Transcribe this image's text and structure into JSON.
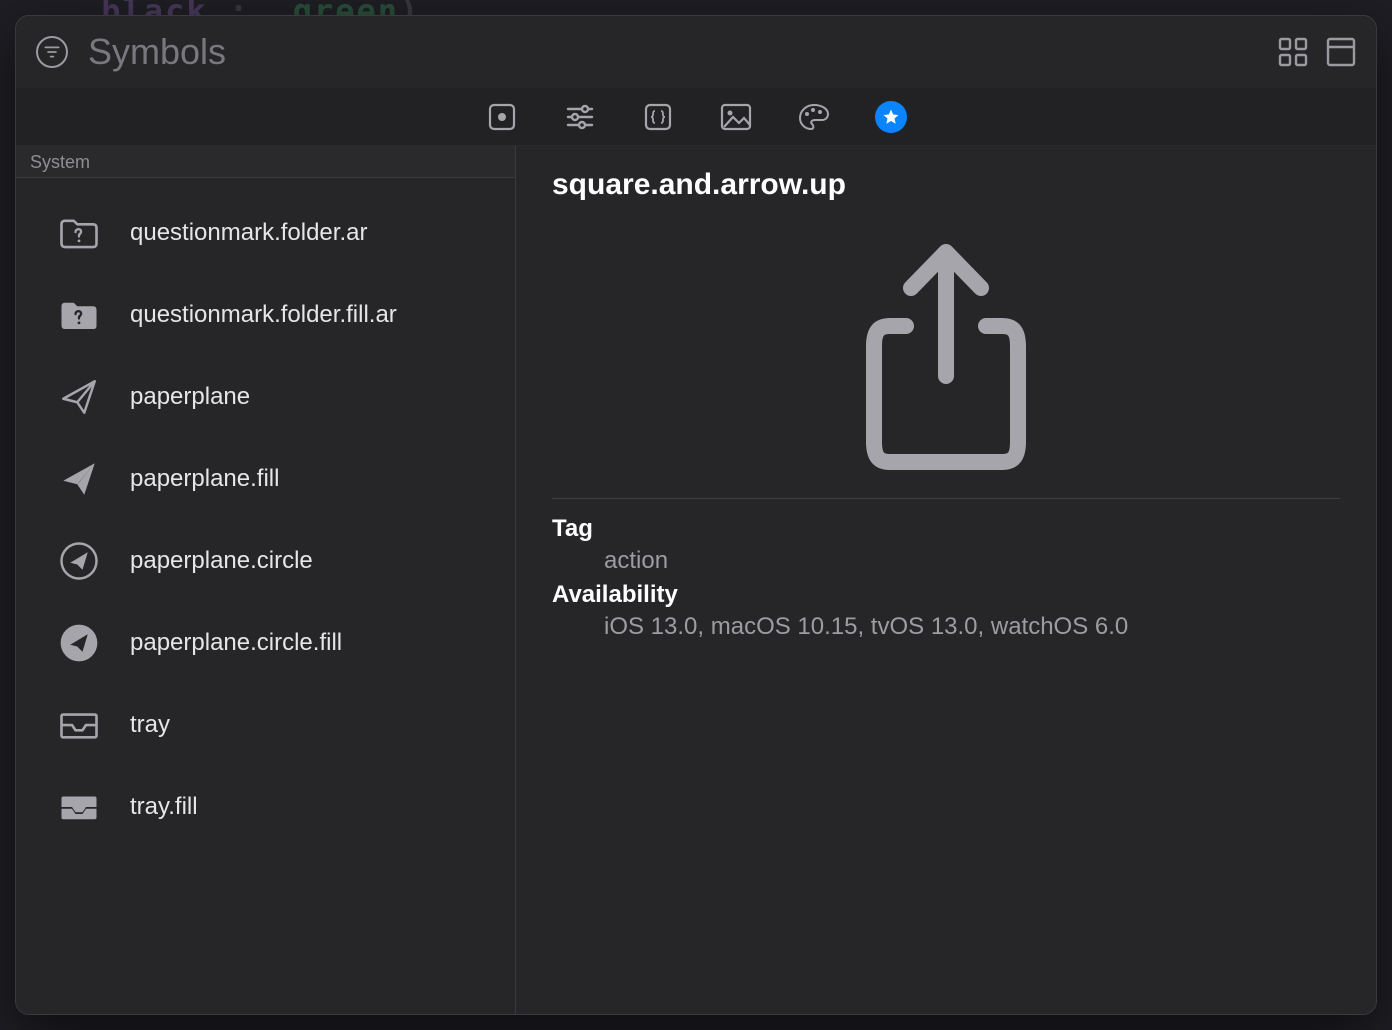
{
  "search": {
    "placeholder": "Symbols",
    "value": ""
  },
  "categories": [
    {
      "id": "frame",
      "active": false
    },
    {
      "id": "sliders",
      "active": false
    },
    {
      "id": "braces",
      "active": false
    },
    {
      "id": "image",
      "active": false
    },
    {
      "id": "palette",
      "active": false
    },
    {
      "id": "star",
      "active": true
    }
  ],
  "section_header": "System",
  "symbols": [
    {
      "name": "questionmark.folder.ar",
      "icon": "folder-question"
    },
    {
      "name": "questionmark.folder.fill.ar",
      "icon": "folder-question-fill"
    },
    {
      "name": "paperplane",
      "icon": "paperplane"
    },
    {
      "name": "paperplane.fill",
      "icon": "paperplane-fill"
    },
    {
      "name": "paperplane.circle",
      "icon": "paperplane-circle"
    },
    {
      "name": "paperplane.circle.fill",
      "icon": "paperplane-circle-fill"
    },
    {
      "name": "tray",
      "icon": "tray"
    },
    {
      "name": "tray.fill",
      "icon": "tray-fill"
    }
  ],
  "detail": {
    "title": "square.and.arrow.up",
    "tag_label": "Tag",
    "tag_value": "action",
    "availability_label": "Availability",
    "availability_value": "iOS 13.0, macOS 10.15, tvOS 13.0, watchOS 6.0"
  },
  "colors": {
    "accent": "#0a84ff",
    "icon": "#a5a5ab",
    "icon_dim": "#8e8e93"
  }
}
